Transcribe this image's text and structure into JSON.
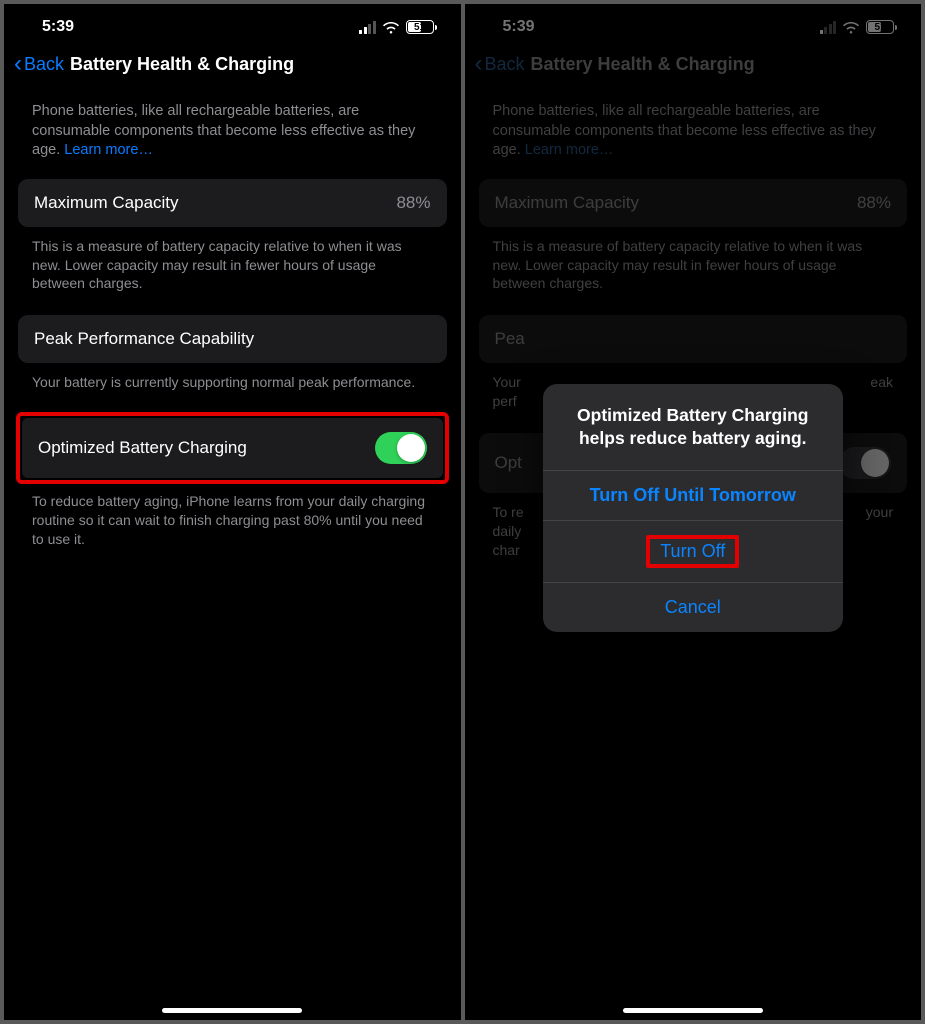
{
  "status": {
    "time": "5:39",
    "battery_pct": "51",
    "battery_fill_pct": 51
  },
  "nav": {
    "back_label": "Back",
    "title": "Battery Health & Charging"
  },
  "intro": {
    "text": "Phone batteries, like all rechargeable batteries, are consumable components that become less effective as they age. ",
    "learn_more": "Learn more…"
  },
  "max_capacity": {
    "label": "Maximum Capacity",
    "value": "88%",
    "footer": "This is a measure of battery capacity relative to when it was new. Lower capacity may result in fewer hours of usage between charges."
  },
  "peak": {
    "label": "Peak Performance Capability",
    "footer": "Your battery is currently supporting normal peak performance."
  },
  "optimized": {
    "label": "Optimized Battery Charging",
    "footer": "To reduce battery aging, iPhone learns from your daily charging routine so it can wait to finish charging past 80% until you need to use it.",
    "toggle_on": true
  },
  "dimmed_panel": {
    "peak_cut": "Pea",
    "peak_footer_cut_a": "Your",
    "peak_footer_cut_b": "eak",
    "peak_footer_cut_c": "perf",
    "opt_cut": "Opt",
    "opt_footer_a": "To re",
    "opt_footer_b": "your",
    "opt_footer_c": "daily",
    "opt_footer_d": "char"
  },
  "sheet": {
    "title": "Optimized Battery Charging helps reduce battery aging.",
    "option_until_tomorrow": "Turn Off Until Tomorrow",
    "option_turn_off": "Turn Off",
    "option_cancel": "Cancel"
  }
}
